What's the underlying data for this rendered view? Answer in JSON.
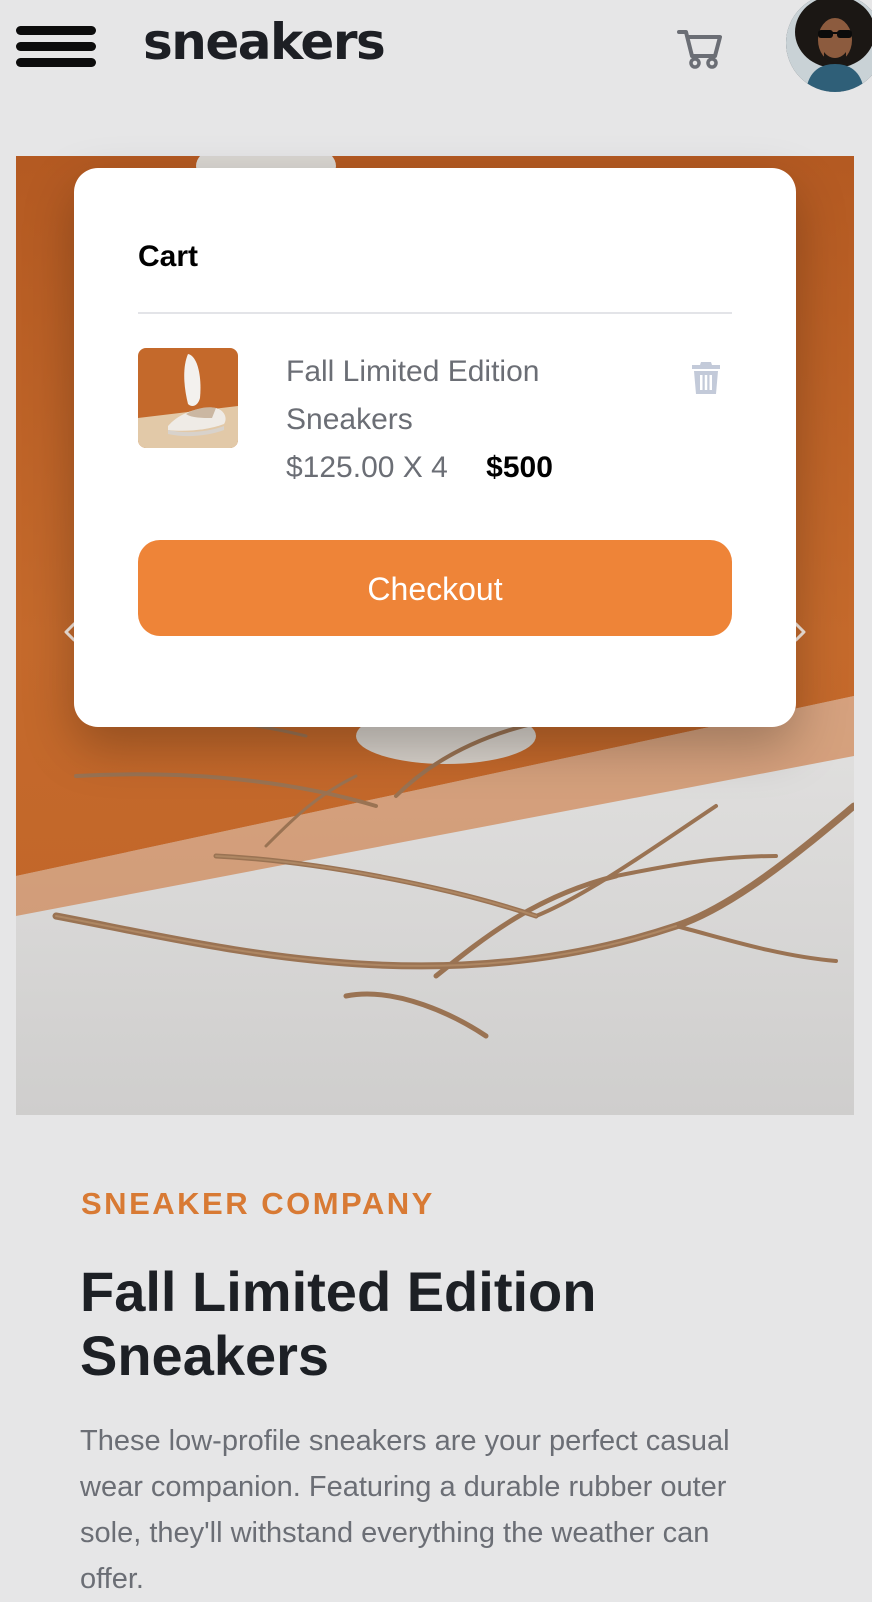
{
  "header": {
    "logo": "sneakers",
    "menu_icon": "hamburger-menu-icon",
    "cart_icon": "cart-icon",
    "avatar_icon": "user-avatar"
  },
  "gallery": {
    "prev_icon": "chevron-left-icon",
    "next_icon": "chevron-right-icon"
  },
  "cart": {
    "title": "Cart",
    "item": {
      "name": "Fall Limited Edition Sneakers",
      "unit_price": "$125.00",
      "multiplier": "X 4",
      "total": "$500",
      "delete_icon": "trash-icon"
    },
    "checkout_label": "Checkout"
  },
  "product": {
    "company": "SNEAKER COMPANY",
    "title": "Fall Limited Edition Sneakers",
    "description": "These low-profile sneakers are your perfect casual wear companion. Featuring a durable rubber outer sole, they'll withstand everything the weather can offer."
  },
  "colors": {
    "accent": "#ee8438",
    "company_label": "#d87a34",
    "background": "#e6e6e7",
    "text_dark": "#1d2025",
    "text_muted": "#6b6e75"
  }
}
